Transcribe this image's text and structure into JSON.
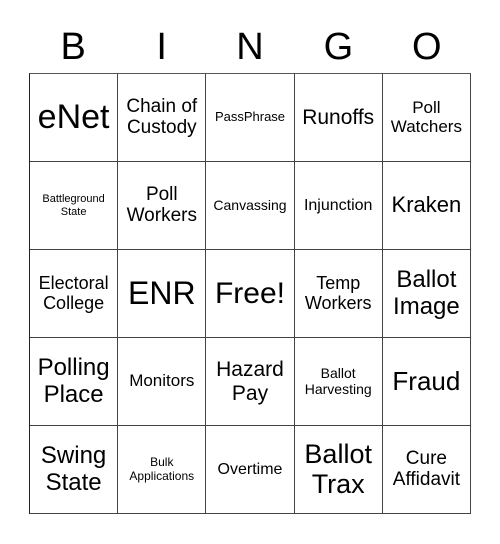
{
  "header": [
    "B",
    "I",
    "N",
    "G",
    "O"
  ],
  "cells": [
    [
      "eNet",
      "Chain of Custody",
      "PassPhrase",
      "Runoffs",
      "Poll Watchers"
    ],
    [
      "Battleground State",
      "Poll Workers",
      "Canvassing",
      "Injunction",
      "Kraken"
    ],
    [
      "Electoral College",
      "ENR",
      "Free!",
      "Temp Workers",
      "Ballot Image"
    ],
    [
      "Polling Place",
      "Monitors",
      "Hazard Pay",
      "Ballot Harvesting",
      "Fraud"
    ],
    [
      "Swing State",
      "Bulk Applications",
      "Overtime",
      "Ballot Trax",
      "Cure Affidavit"
    ]
  ]
}
